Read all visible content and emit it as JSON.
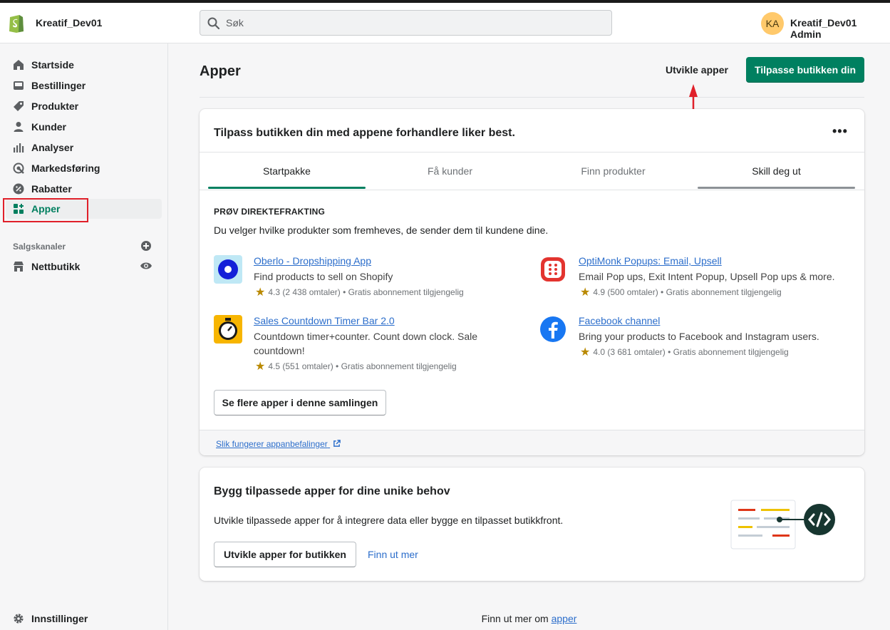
{
  "store": {
    "name": "Kreatif_Dev01"
  },
  "search": {
    "placeholder": "Søk"
  },
  "user": {
    "initials": "KA",
    "name": "Kreatif_Dev01 Admin"
  },
  "sidebar": {
    "items": [
      {
        "label": "Startside",
        "icon": "home-icon"
      },
      {
        "label": "Bestillinger",
        "icon": "orders-icon"
      },
      {
        "label": "Produkter",
        "icon": "tag-icon"
      },
      {
        "label": "Kunder",
        "icon": "customer-icon"
      },
      {
        "label": "Analyser",
        "icon": "analytics-icon"
      },
      {
        "label": "Markedsføring",
        "icon": "marketing-icon"
      },
      {
        "label": "Rabatter",
        "icon": "discount-icon"
      },
      {
        "label": "Apper",
        "icon": "apps-icon",
        "active": true
      }
    ],
    "sales_channels_label": "Salgskanaler",
    "channels": [
      {
        "label": "Nettbutikk",
        "icon": "store-icon"
      }
    ],
    "settings_label": "Innstillinger"
  },
  "page": {
    "title": "Apper",
    "develop_apps_label": "Utvikle apper",
    "customize_button": "Tilpasse butikken din"
  },
  "recommend_card": {
    "title": "Tilpass butikken din med appene forhandlere liker best.",
    "tabs": [
      "Startpakke",
      "Få kunder",
      "Finn produkter",
      "Skill deg ut"
    ],
    "active_tab": "Startpakke",
    "collection_heading": "PRØV DIREKTEFRAKTING",
    "collection_desc": "Du velger hvilke produkter som fremheves, de sender dem til kundene dine.",
    "apps": [
      {
        "name": "Oberlo - Dropshipping App",
        "desc": "Find products to sell on Shopify",
        "meta": "4.3 (2 438 omtaler) • Gratis abonnement tilgjengelig",
        "icon": "oberlo-icon"
      },
      {
        "name": "OptiMonk Popups: Email, Upsell",
        "desc": "Email Pop ups, Exit Intent Popup, Upsell Pop ups & more.",
        "meta": "4.9 (500 omtaler) • Gratis abonnement tilgjengelig",
        "icon": "optimonk-icon"
      },
      {
        "name": "Sales Countdown Timer Bar 2.0",
        "desc": "Countdown timer+counter. Count down clock. Sale countdown!",
        "meta": "4.5 (551 omtaler) • Gratis abonnement tilgjengelig",
        "icon": "stopwatch-icon"
      },
      {
        "name": "Facebook channel",
        "desc": "Bring your products to Facebook and Instagram users.",
        "meta": "4.0 (3 681 omtaler) • Gratis abonnement tilgjengelig",
        "icon": "facebook-icon"
      }
    ],
    "more_apps_button": "Se flere apper i denne samlingen",
    "how_it_works_link": "Slik fungerer appanbefalinger"
  },
  "custom_card": {
    "title": "Bygg tilpassede apper for dine unike behov",
    "desc": "Utvikle tilpassede apper for å integrere data eller bygge en tilpasset butikkfront.",
    "develop_button": "Utvikle apper for butikken",
    "learn_more": "Finn ut mer"
  },
  "footer": {
    "prefix": "Finn ut mer om ",
    "link": "apper"
  },
  "colors": {
    "primary": "#008060",
    "link": "#2c6ecb",
    "highlight": "#e0202a"
  }
}
